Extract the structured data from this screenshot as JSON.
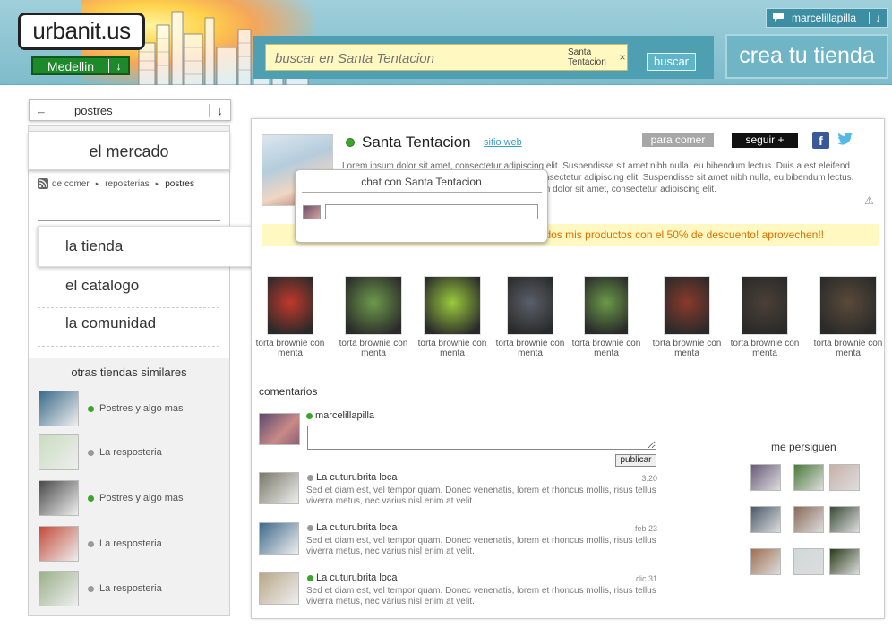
{
  "header": {
    "logo": "urbanit.us",
    "city": "Medellin",
    "search_placeholder": "buscar en Santa Tentacion",
    "search_chip": "Santa Tentacion",
    "search_chip_close": "×",
    "search_button": "buscar",
    "create_store": "crea tu tienda",
    "username": "marcelillapilla",
    "chat_icon": "speech-bubble-icon",
    "down_arrow": "↓"
  },
  "sidebar": {
    "category": "postres",
    "back_arrow": "←",
    "down_arrow": "↓",
    "market": "el mercado",
    "breadcrumb": [
      "de comer",
      "reposterias",
      "postres"
    ],
    "breadcrumb_sep": "▸",
    "nav": [
      "la tienda",
      "el catalogo",
      "la comunidad"
    ],
    "similar_title": "otras tiendas similares",
    "similar": [
      {
        "label": "Postres y algo mas",
        "online": true,
        "color": "#3b6b8a"
      },
      {
        "label": "La resposteria",
        "online": false,
        "color": "#c9dcc0"
      },
      {
        "label": "Postres y algo mas",
        "online": true,
        "color": "#4a4a4a"
      },
      {
        "label": "La resposteria",
        "online": false,
        "color": "#c24b3a"
      },
      {
        "label": "La resposteria",
        "online": false,
        "color": "#9bb08a"
      }
    ]
  },
  "store": {
    "name": "Santa Tentacion",
    "website": "sitio web",
    "category_badge": "para comer",
    "follow": "seguir +",
    "facebook": "f",
    "twitter": "t",
    "description": "Lorem ipsum dolor sit amet, consectetur adipiscing elit. Suspendisse sit amet nibh nulla, eu bibendum lectus. Duis a est eleifend odio luctus suscipit. Lorem ipsum dolor sit amet, consectetur adipiscing elit. Suspendisse sit amet nibh nulla, eu bibendum lectus. Duis a est eleifend odio luctus suscipit. Lorem ipsum dolor sit amet, consectetur adipiscing elit.",
    "warning_icon": "⚠",
    "promo": "Hoy todos mis productos con el 50% de descuento! aprovechen!!"
  },
  "chat": {
    "title": "chat con Santa Tentacion"
  },
  "products": [
    {
      "label": "torta brownie con menta",
      "color": "#c2382a"
    },
    {
      "label": "torta brownie con menta",
      "color": "#6d9a4a"
    },
    {
      "label": "torta brownie con menta",
      "color": "#9acb3c"
    },
    {
      "label": "torta brownie con menta",
      "color": "#5a6068"
    },
    {
      "label": "torta brownie con menta",
      "color": "#6a9a48"
    },
    {
      "label": "torta brownie con menta",
      "color": "#8a3a2a"
    },
    {
      "label": "torta brownie con menta",
      "color": "#4a4038"
    },
    {
      "label": "torta brownie con menta",
      "color": "#5a4a3a"
    }
  ],
  "comments_section": {
    "title": "comentarios",
    "current_user": "marcelillapilla",
    "publish": "publicar",
    "items": [
      {
        "name": "La cuturubrita loca",
        "time": "3:20",
        "online": false,
        "color": "#7a7a6a",
        "text": "Sed et diam est, vel tempor quam. Donec venenatis, lorem et rhoncus mollis, risus tellus viverra metus, nec varius nisl enim at velit."
      },
      {
        "name": "La cuturubrita loca",
        "time": "feb 23",
        "online": false,
        "color": "#3e6a8a",
        "text": "Sed et diam est, vel tempor quam. Donec venenatis, lorem et rhoncus mollis, risus tellus viverra metus, nec varius nisl enim at velit."
      },
      {
        "name": "La cuturubrita loca",
        "time": "dic 31",
        "online": true,
        "color": "#b8a88a",
        "text": "Sed et diam est, vel tempor quam. Donec venenatis, lorem et rhoncus mollis, risus tellus viverra metus, nec varius nisl enim at velit."
      }
    ]
  },
  "followers": {
    "title": "me persiguen",
    "colors": [
      "#6a5a7a",
      "#4a7a3a",
      "#c8b0a8",
      "#4a5a6a",
      "#8a6a5a",
      "#3a4a3a",
      "#a07050",
      "#d0d8d8",
      "#2a3a1a"
    ]
  }
}
